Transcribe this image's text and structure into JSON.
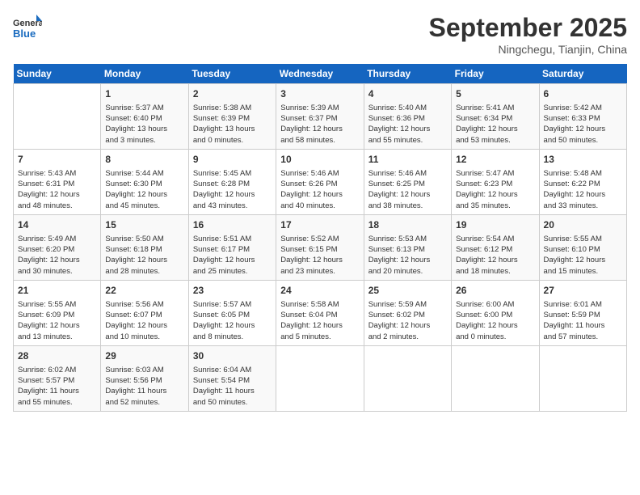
{
  "header": {
    "logo_line1": "General",
    "logo_line2": "Blue",
    "month": "September 2025",
    "location": "Ningchegu, Tianjin, China"
  },
  "days_of_week": [
    "Sunday",
    "Monday",
    "Tuesday",
    "Wednesday",
    "Thursday",
    "Friday",
    "Saturday"
  ],
  "weeks": [
    [
      {
        "day": "",
        "content": ""
      },
      {
        "day": "1",
        "content": "Sunrise: 5:37 AM\nSunset: 6:40 PM\nDaylight: 13 hours\nand 3 minutes."
      },
      {
        "day": "2",
        "content": "Sunrise: 5:38 AM\nSunset: 6:39 PM\nDaylight: 13 hours\nand 0 minutes."
      },
      {
        "day": "3",
        "content": "Sunrise: 5:39 AM\nSunset: 6:37 PM\nDaylight: 12 hours\nand 58 minutes."
      },
      {
        "day": "4",
        "content": "Sunrise: 5:40 AM\nSunset: 6:36 PM\nDaylight: 12 hours\nand 55 minutes."
      },
      {
        "day": "5",
        "content": "Sunrise: 5:41 AM\nSunset: 6:34 PM\nDaylight: 12 hours\nand 53 minutes."
      },
      {
        "day": "6",
        "content": "Sunrise: 5:42 AM\nSunset: 6:33 PM\nDaylight: 12 hours\nand 50 minutes."
      }
    ],
    [
      {
        "day": "7",
        "content": "Sunrise: 5:43 AM\nSunset: 6:31 PM\nDaylight: 12 hours\nand 48 minutes."
      },
      {
        "day": "8",
        "content": "Sunrise: 5:44 AM\nSunset: 6:30 PM\nDaylight: 12 hours\nand 45 minutes."
      },
      {
        "day": "9",
        "content": "Sunrise: 5:45 AM\nSunset: 6:28 PM\nDaylight: 12 hours\nand 43 minutes."
      },
      {
        "day": "10",
        "content": "Sunrise: 5:46 AM\nSunset: 6:26 PM\nDaylight: 12 hours\nand 40 minutes."
      },
      {
        "day": "11",
        "content": "Sunrise: 5:46 AM\nSunset: 6:25 PM\nDaylight: 12 hours\nand 38 minutes."
      },
      {
        "day": "12",
        "content": "Sunrise: 5:47 AM\nSunset: 6:23 PM\nDaylight: 12 hours\nand 35 minutes."
      },
      {
        "day": "13",
        "content": "Sunrise: 5:48 AM\nSunset: 6:22 PM\nDaylight: 12 hours\nand 33 minutes."
      }
    ],
    [
      {
        "day": "14",
        "content": "Sunrise: 5:49 AM\nSunset: 6:20 PM\nDaylight: 12 hours\nand 30 minutes."
      },
      {
        "day": "15",
        "content": "Sunrise: 5:50 AM\nSunset: 6:18 PM\nDaylight: 12 hours\nand 28 minutes."
      },
      {
        "day": "16",
        "content": "Sunrise: 5:51 AM\nSunset: 6:17 PM\nDaylight: 12 hours\nand 25 minutes."
      },
      {
        "day": "17",
        "content": "Sunrise: 5:52 AM\nSunset: 6:15 PM\nDaylight: 12 hours\nand 23 minutes."
      },
      {
        "day": "18",
        "content": "Sunrise: 5:53 AM\nSunset: 6:13 PM\nDaylight: 12 hours\nand 20 minutes."
      },
      {
        "day": "19",
        "content": "Sunrise: 5:54 AM\nSunset: 6:12 PM\nDaylight: 12 hours\nand 18 minutes."
      },
      {
        "day": "20",
        "content": "Sunrise: 5:55 AM\nSunset: 6:10 PM\nDaylight: 12 hours\nand 15 minutes."
      }
    ],
    [
      {
        "day": "21",
        "content": "Sunrise: 5:55 AM\nSunset: 6:09 PM\nDaylight: 12 hours\nand 13 minutes."
      },
      {
        "day": "22",
        "content": "Sunrise: 5:56 AM\nSunset: 6:07 PM\nDaylight: 12 hours\nand 10 minutes."
      },
      {
        "day": "23",
        "content": "Sunrise: 5:57 AM\nSunset: 6:05 PM\nDaylight: 12 hours\nand 8 minutes."
      },
      {
        "day": "24",
        "content": "Sunrise: 5:58 AM\nSunset: 6:04 PM\nDaylight: 12 hours\nand 5 minutes."
      },
      {
        "day": "25",
        "content": "Sunrise: 5:59 AM\nSunset: 6:02 PM\nDaylight: 12 hours\nand 2 minutes."
      },
      {
        "day": "26",
        "content": "Sunrise: 6:00 AM\nSunset: 6:00 PM\nDaylight: 12 hours\nand 0 minutes."
      },
      {
        "day": "27",
        "content": "Sunrise: 6:01 AM\nSunset: 5:59 PM\nDaylight: 11 hours\nand 57 minutes."
      }
    ],
    [
      {
        "day": "28",
        "content": "Sunrise: 6:02 AM\nSunset: 5:57 PM\nDaylight: 11 hours\nand 55 minutes."
      },
      {
        "day": "29",
        "content": "Sunrise: 6:03 AM\nSunset: 5:56 PM\nDaylight: 11 hours\nand 52 minutes."
      },
      {
        "day": "30",
        "content": "Sunrise: 6:04 AM\nSunset: 5:54 PM\nDaylight: 11 hours\nand 50 minutes."
      },
      {
        "day": "",
        "content": ""
      },
      {
        "day": "",
        "content": ""
      },
      {
        "day": "",
        "content": ""
      },
      {
        "day": "",
        "content": ""
      }
    ]
  ]
}
